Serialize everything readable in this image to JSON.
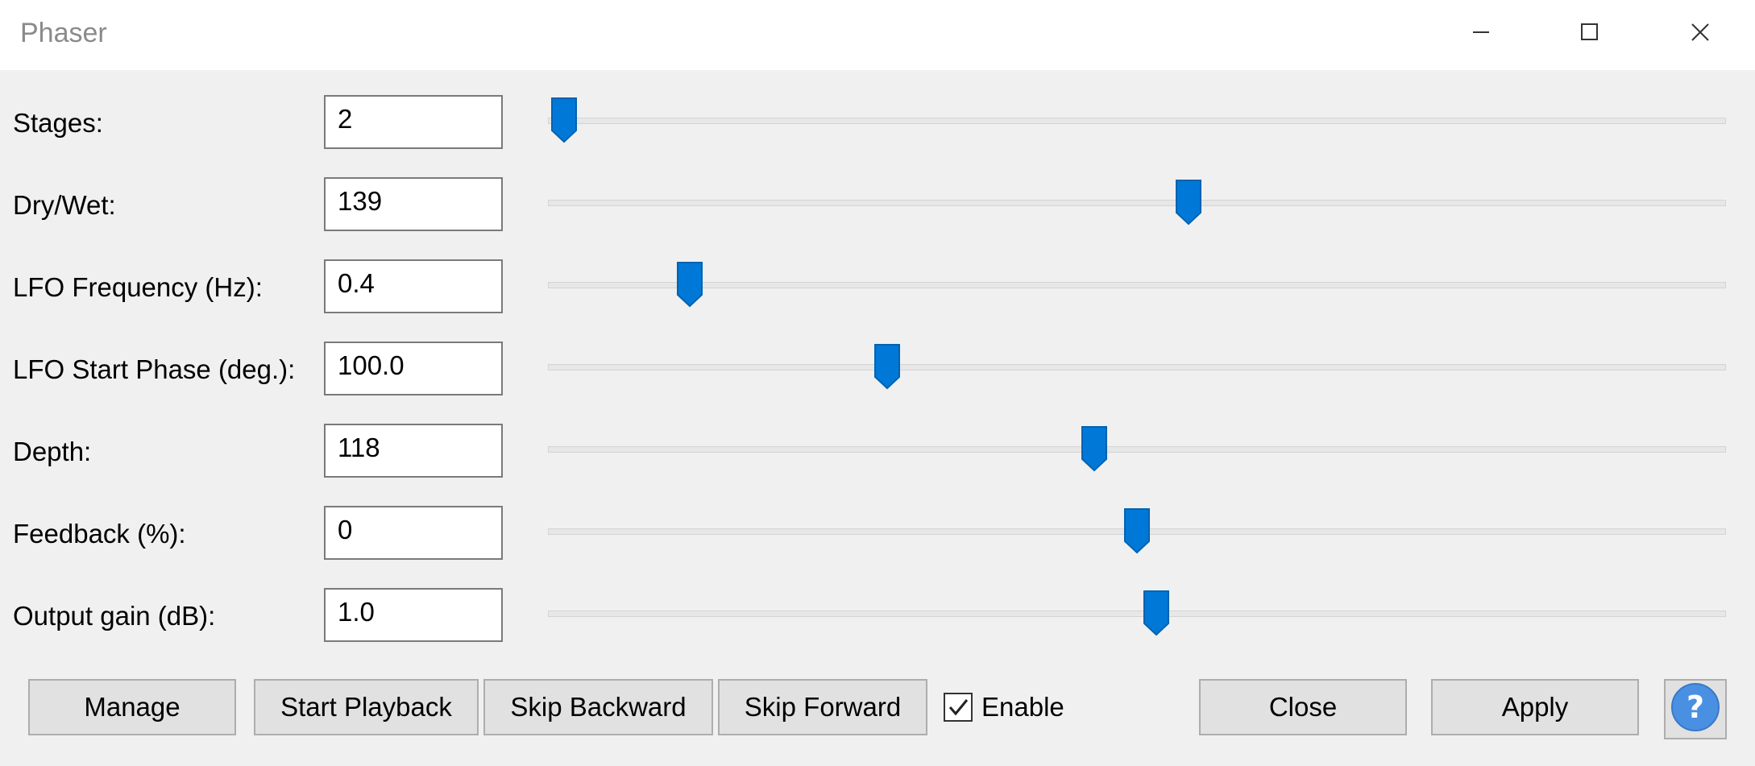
{
  "window": {
    "title": "Phaser",
    "minimize_icon": "minimize-icon",
    "maximize_icon": "maximize-icon",
    "close_icon": "close-icon"
  },
  "params": [
    {
      "label": "Stages:",
      "value": "2",
      "level": 0.0
    },
    {
      "label": "Dry/Wet:",
      "value": "139",
      "level": 0.545
    },
    {
      "label": "LFO Frequency (Hz):",
      "value": "0.4",
      "level": 0.11
    },
    {
      "label": "LFO Start Phase (deg.):",
      "value": "100.0",
      "level": 0.282
    },
    {
      "label": "Depth:",
      "value": "118",
      "level": 0.463
    },
    {
      "label": "Feedback (%):",
      "value": "0",
      "level": 0.5
    },
    {
      "label": "Output gain (dB):",
      "value": "1.0",
      "level": 0.517
    }
  ],
  "buttons": {
    "manage": "Manage",
    "start_playback": "Start Playback",
    "skip_backward": "Skip Backward",
    "skip_forward": "Skip Forward",
    "close": "Close",
    "apply": "Apply"
  },
  "enable": {
    "label": "Enable",
    "checked": true
  },
  "help_icon": "help-icon",
  "colors": {
    "accent": "#0078d7",
    "background": "#f0f0f0"
  }
}
